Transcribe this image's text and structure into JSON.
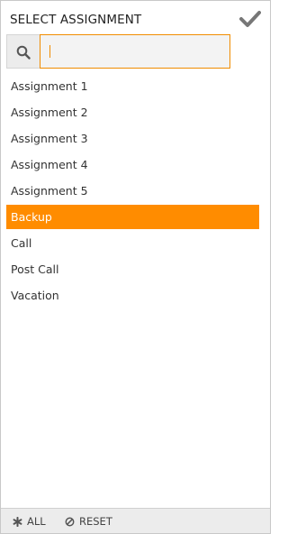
{
  "header": {
    "title": "SELECT ASSIGNMENT",
    "confirm_icon": "checkmark-icon"
  },
  "search": {
    "icon": "search-icon",
    "value": "",
    "placeholder": ""
  },
  "assignments": {
    "items": [
      {
        "label": "Assignment 1",
        "selected": false
      },
      {
        "label": "Assignment 2",
        "selected": false
      },
      {
        "label": "Assignment 3",
        "selected": false
      },
      {
        "label": "Assignment 4",
        "selected": false
      },
      {
        "label": "Assignment 5",
        "selected": false
      },
      {
        "label": "Backup",
        "selected": true
      },
      {
        "label": "Call",
        "selected": false
      },
      {
        "label": "Post Call",
        "selected": false
      },
      {
        "label": "Vacation",
        "selected": false
      }
    ]
  },
  "footer": {
    "all_label": "ALL",
    "all_icon": "asterisk-icon",
    "reset_label": "RESET",
    "reset_icon": "ban-icon"
  },
  "colors": {
    "accent": "#ff8c00",
    "input_border": "#f08c00",
    "footer_bg": "#ececec"
  }
}
